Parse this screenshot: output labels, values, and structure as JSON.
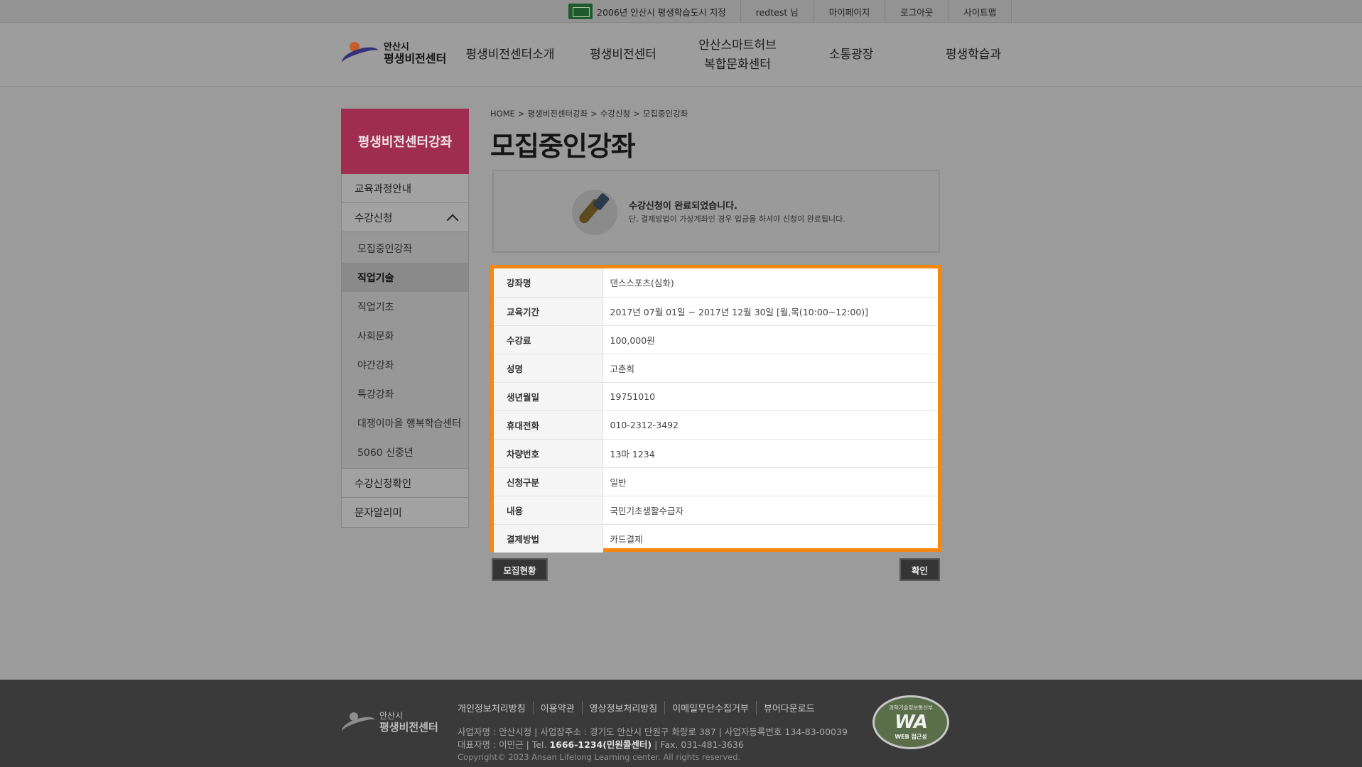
{
  "topbar": {
    "badge": "2006년 안산시 평생학습도시 지정",
    "user": "redtest 님",
    "mypage": "마이페이지",
    "logout": "로그아웃",
    "sitemap": "사이트맵"
  },
  "logo": {
    "line1": "안산시",
    "line2": "평생비전센터"
  },
  "gnb": [
    {
      "label": "평생비전센터소개"
    },
    {
      "label": "평생비전센터"
    },
    {
      "label": "안산스마트허브\n복합문화센터"
    },
    {
      "label": "소통광장"
    },
    {
      "label": "평생학습과"
    }
  ],
  "sidebar": {
    "title": "평생비전센터강좌",
    "items": [
      {
        "label": "교육과정안내"
      },
      {
        "label": "수강신청"
      },
      {
        "label": "수강신청확인"
      },
      {
        "label": "문자알리미"
      }
    ],
    "subitems": [
      {
        "label": "모집중인강좌"
      },
      {
        "label": "직업기술"
      },
      {
        "label": "직업기초"
      },
      {
        "label": "사회문화"
      },
      {
        "label": "야간강좌"
      },
      {
        "label": "특강강좌"
      },
      {
        "label": "대쟁이마을 행복학습센터"
      },
      {
        "label": "5060 신중년"
      }
    ]
  },
  "breadcrumb": [
    "HOME",
    "평생비전센터강좌",
    "수강신청",
    "모집중인강좌"
  ],
  "page_title": "모집중인강좌",
  "notice": {
    "title": "수강신청이 완료되었습니다.",
    "desc": "단, 결제방법이 가상계좌인 경우 입금을 하셔야 신청이 완료됩니다."
  },
  "info_rows": [
    {
      "label": "강좌명",
      "value": "댄스스포츠(심화)"
    },
    {
      "label": "교육기간",
      "value": "2017년 07월 01일 ~ 2017년 12월 30일 [월,목(10:00~12:00)]"
    },
    {
      "label": "수강료",
      "value": "100,000원"
    },
    {
      "label": "성명",
      "value": "고춘희"
    },
    {
      "label": "생년월일",
      "value": "19751010"
    },
    {
      "label": "휴대전화",
      "value": "010-2312-3492"
    },
    {
      "label": "차량번호",
      "value": "13마 1234"
    },
    {
      "label": "신청구분",
      "value": "일반"
    },
    {
      "label": "내용",
      "value": "국민기초생활수급자"
    },
    {
      "label": "결제방법",
      "value": "카드결제"
    }
  ],
  "buttons": {
    "status": "모집현황",
    "confirm": "확인"
  },
  "footer": {
    "logo_line1": "안산시",
    "logo_line2": "평생비전센터",
    "links": [
      "개인정보처리방침",
      "이용약관",
      "영상정보처리방침",
      "이메일무단수집거부",
      "뷰어다운로드"
    ],
    "biz_line": "사업자명 : 안산시청 | 사업장주소 : 경기도 안산시 단원구 화랑로 387 | 사업자등록번호 134-83-00039",
    "rep_prefix": "대표자명 : 이민근 | Tel. ",
    "tel": "1666-1234(민원콜센터)",
    "fax": " | Fax. 031-481-3636",
    "copyright": "Copyright© 2023 Ansan Lifelong Learning center. All rights reserved.",
    "wa_top": "과학기술정보통신부",
    "wa_mark": "WA",
    "wa_bottom": "WEB 접근성"
  },
  "colors": {
    "accent": "#9e2d51",
    "highlight": "#f7870f"
  }
}
